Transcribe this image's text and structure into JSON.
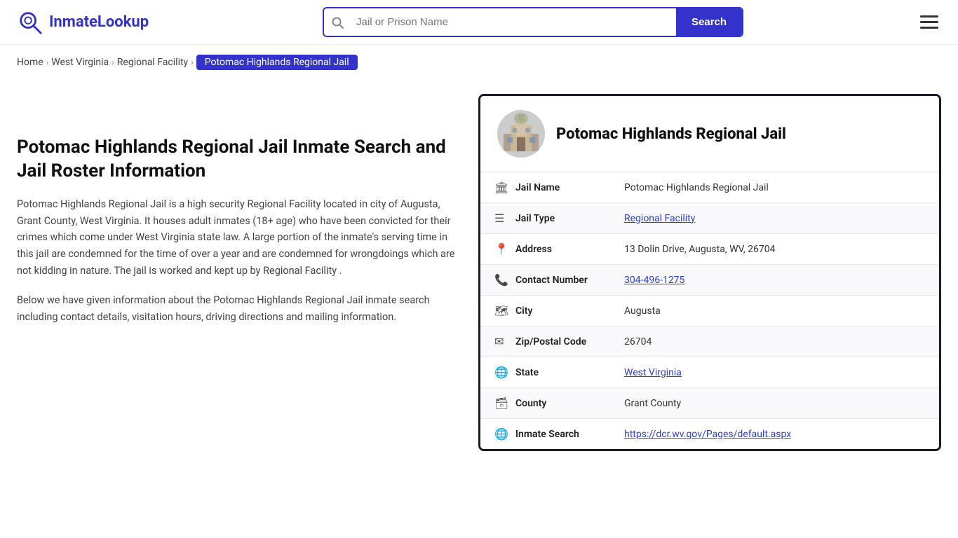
{
  "header": {
    "logo_text": "InmateLookup",
    "search_placeholder": "Jail or Prison Name",
    "search_button_label": "Search"
  },
  "breadcrumb": {
    "items": [
      {
        "label": "Home",
        "href": "#"
      },
      {
        "label": "West Virginia",
        "href": "#"
      },
      {
        "label": "Regional Facility",
        "href": "#"
      },
      {
        "label": "Potomac Highlands Regional Jail",
        "active": true
      }
    ]
  },
  "left": {
    "page_title": "Potomac Highlands Regional Jail Inmate Search and Jail Roster Information",
    "desc1": "Potomac Highlands Regional Jail is a high security Regional Facility located in city of Augusta, Grant County, West Virginia. It houses adult inmates (18+ age) who have been convicted for their crimes which come under West Virginia state law. A large portion of the inmate's serving time in this jail are condemned for the time of over a year and are condemned for wrongdoings which are not kidding in nature. The jail is worked and kept up by Regional Facility .",
    "desc2": "Below we have given information about the Potomac Highlands Regional Jail inmate search including contact details, visitation hours, driving directions and mailing information."
  },
  "card": {
    "title": "Potomac Highlands Regional Jail",
    "rows": [
      {
        "icon": "jail-icon",
        "label": "Jail Name",
        "value": "Potomac Highlands Regional Jail",
        "link": null
      },
      {
        "icon": "type-icon",
        "label": "Jail Type",
        "value": "Regional Facility",
        "link": "#"
      },
      {
        "icon": "address-icon",
        "label": "Address",
        "value": "13 Dolin Drive, Augusta, WV, 26704",
        "link": null
      },
      {
        "icon": "phone-icon",
        "label": "Contact Number",
        "value": "304-496-1275",
        "link": "tel:304-496-1275"
      },
      {
        "icon": "city-icon",
        "label": "City",
        "value": "Augusta",
        "link": null
      },
      {
        "icon": "zip-icon",
        "label": "Zip/Postal Code",
        "value": "26704",
        "link": null
      },
      {
        "icon": "state-icon",
        "label": "State",
        "value": "West Virginia",
        "link": "#"
      },
      {
        "icon": "county-icon",
        "label": "County",
        "value": "Grant County",
        "link": null
      },
      {
        "icon": "globe-icon",
        "label": "Inmate Search",
        "value": "https://dcr.wv.gov/Pages/default.aspx",
        "link": "https://dcr.wv.gov/Pages/default.aspx"
      }
    ]
  }
}
